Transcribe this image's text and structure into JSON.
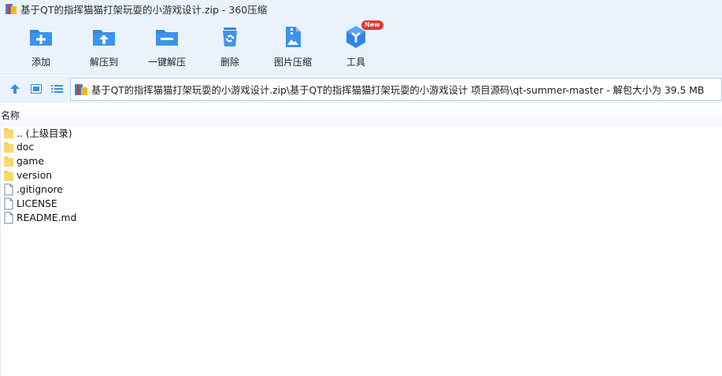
{
  "window": {
    "title": "基于QT的指挥猫猫打架玩耍的小游戏设计.zip - 360压缩",
    "app_icon": "archive-app-icon"
  },
  "toolbar": {
    "items": [
      {
        "label": "添加",
        "icon": "add-folder-icon"
      },
      {
        "label": "解压到",
        "icon": "extract-to-icon"
      },
      {
        "label": "一键解压",
        "icon": "one-click-extract-icon"
      },
      {
        "label": "删除",
        "icon": "recycle-bin-icon"
      },
      {
        "label": "图片压缩",
        "icon": "image-compress-icon"
      },
      {
        "label": "工具",
        "icon": "tools-cube-icon",
        "badge": "New"
      }
    ]
  },
  "addressbar": {
    "path": "基于QT的指挥猫猫打架玩耍的小游戏设计.zip\\基于QT的指挥猫猫打架玩耍的小游戏设计 项目源码\\qt-summer-master - 解包大小为 39.5 MB"
  },
  "list": {
    "column_name": "名称",
    "rows": [
      {
        "name": ".. (上级目录)",
        "type": "folder"
      },
      {
        "name": "doc",
        "type": "folder"
      },
      {
        "name": "game",
        "type": "folder"
      },
      {
        "name": "version",
        "type": "folder"
      },
      {
        "name": ".gitignore",
        "type": "file"
      },
      {
        "name": "LICENSE",
        "type": "file"
      },
      {
        "name": "README.md",
        "type": "file"
      }
    ]
  },
  "colors": {
    "accent": "#2f86e0",
    "toolbar_bg": "#eaf3fc",
    "folder": "#f6cf5a",
    "badge": "#e8322a"
  }
}
